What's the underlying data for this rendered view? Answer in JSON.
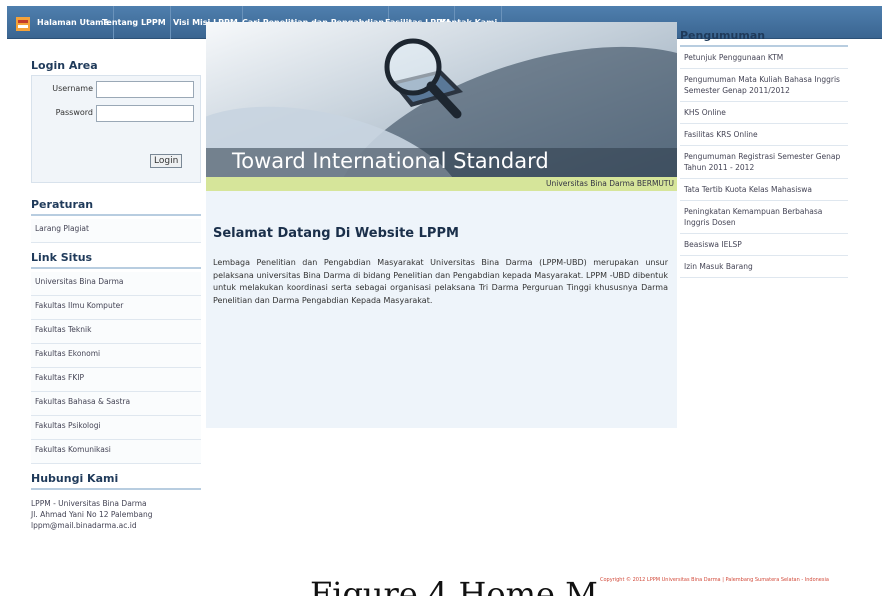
{
  "nav": {
    "items": [
      "Halaman Utama",
      "Tentang LPPM",
      "Visi Misi LPPM",
      "Cari Penelitian dan Pengabdian",
      "Fasilitas LPPM",
      "Kontak Kami"
    ]
  },
  "login": {
    "title": "Login Area",
    "username_label": "Username",
    "password_label": "Password",
    "button": "Login"
  },
  "peraturan": {
    "title": "Peraturan",
    "items": [
      "Larang Plagiat"
    ]
  },
  "links": {
    "title": "Link Situs",
    "items": [
      "Universitas Bina Darma",
      "Fakultas Ilmu Komputer",
      "Fakultas Teknik",
      "Fakultas Ekonomi",
      "Fakultas FKIP",
      "Fakultas Bahasa & Sastra",
      "Fakultas Psikologi",
      "Fakultas Komunikasi"
    ]
  },
  "contact": {
    "title": "Hubungi Kami",
    "lines": [
      "LPPM - Universitas Bina Darma",
      "Jl. Ahmad Yani No 12 Palembang",
      "lppm@mail.binadarma.ac.id"
    ]
  },
  "banner": {
    "caption": "Toward International Standard",
    "marquee": "Universitas Bina Darma BERMUTU"
  },
  "main": {
    "heading": "Selamat Datang Di Website LPPM",
    "body": "Lembaga Penelitian dan Pengabdian Masyarakat Universitas Bina Darma (LPPM-UBD) merupakan unsur pelaksana universitas Bina Darma di bidang Penelitian dan Pengabdian kepada Masyarakat. LPPM -UBD dibentuk untuk melakukan koordinasi serta sebagai organisasi pelaksana Tri Darma Perguruan Tinggi khususnya Darma Penelitian dan Darma Pengabdian Kepada Masyarakat."
  },
  "announcements": {
    "title": "Pengumuman",
    "items": [
      "Petunjuk Penggunaan KTM",
      "Pengumuman Mata Kuliah Bahasa Inggris Semester Genap 2011/2012",
      "KHS Online",
      "Fasilitas KRS Online",
      "Pengumuman Registrasi Semester Genap Tahun 2011 - 2012",
      "Tata Tertib Kuota Kelas Mahasiswa",
      "Peningkatan Kemampuan Berbahasa Inggris Dosen",
      "Beasiswa IELSP",
      "Izin Masuk Barang"
    ]
  },
  "footer": {
    "copyright": "Copyright © 2012 LPPM Universitas Bina Darma | Palembang Sumatera Selatan - Indonesia"
  },
  "overlay_caption": "Figure 4 Home M"
}
